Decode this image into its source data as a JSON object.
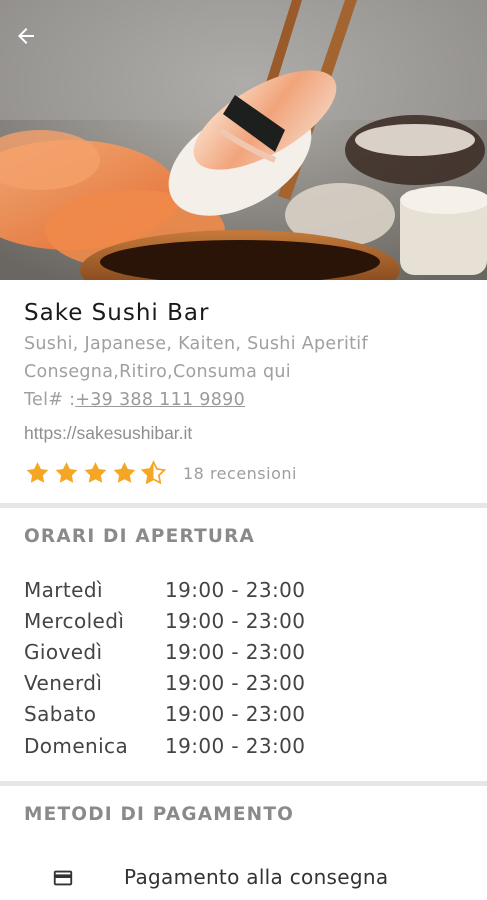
{
  "header": {
    "back_icon": "arrow-left-icon",
    "hero_image": "sushi-with-chopsticks-photo"
  },
  "restaurant": {
    "name": "Sake Sushi Bar",
    "categories": "Sushi, Japanese, Kaiten, Sushi Aperitif",
    "services": "Consegna,Ritiro,Consuma qui",
    "phone_prefix": "Tel# :",
    "phone": "+39 388 111 9890",
    "website": "https://sakesushibar.it",
    "rating": 4.5,
    "rating_max": 5,
    "reviews": "18 recensioni",
    "star_color": "#F5A623"
  },
  "opening_hours": {
    "title": "ORARI DI APERTURA",
    "days": [
      {
        "day": "Martedì",
        "time": "19:00 - 23:00"
      },
      {
        "day": "Mercoledì",
        "time": "19:00 - 23:00"
      },
      {
        "day": "Giovedì",
        "time": "19:00 - 23:00"
      },
      {
        "day": "Venerdì",
        "time": "19:00 - 23:00"
      },
      {
        "day": "Sabato",
        "time": "19:00 - 23:00"
      },
      {
        "day": "Domenica",
        "time": "19:00 - 23:00"
      }
    ]
  },
  "payment": {
    "title": "METODI DI PAGAMENTO",
    "methods": [
      {
        "icon": "credit-card-icon",
        "label": "Pagamento alla consegna"
      }
    ]
  }
}
